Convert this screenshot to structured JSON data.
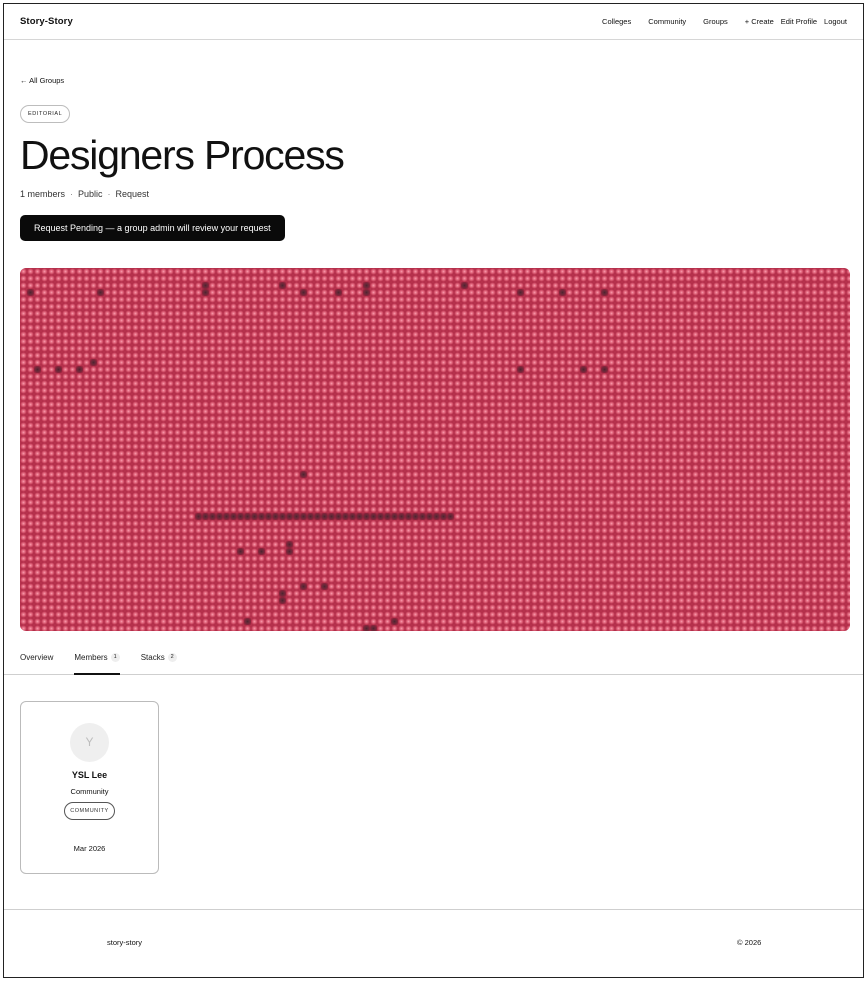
{
  "nav": {
    "brand": "Story-Story",
    "links": [
      "Colleges",
      "Community",
      "Groups",
      "+ Create",
      "Edit Profile",
      "Logout"
    ]
  },
  "group": {
    "back_link": "← All Groups",
    "category_tag": "EDITORIAL",
    "title": "Designers Process",
    "members_count": "1 members",
    "visibility": "Public",
    "join_type": "Request",
    "pending_button": "Request Pending — a group admin will review your request",
    "banner_color": "#c23a55"
  },
  "tabs": [
    {
      "label": "Overview",
      "count": null
    },
    {
      "label": "Members",
      "count": "1"
    },
    {
      "label": "Stacks",
      "count": "2"
    }
  ],
  "members": [
    {
      "initial": "Y",
      "name": "YSL Lee",
      "role": "Community",
      "badge": "COMMUNITY",
      "joined": "Mar 2026"
    }
  ],
  "footer": {
    "left": "story-story",
    "right": "© 2026"
  }
}
